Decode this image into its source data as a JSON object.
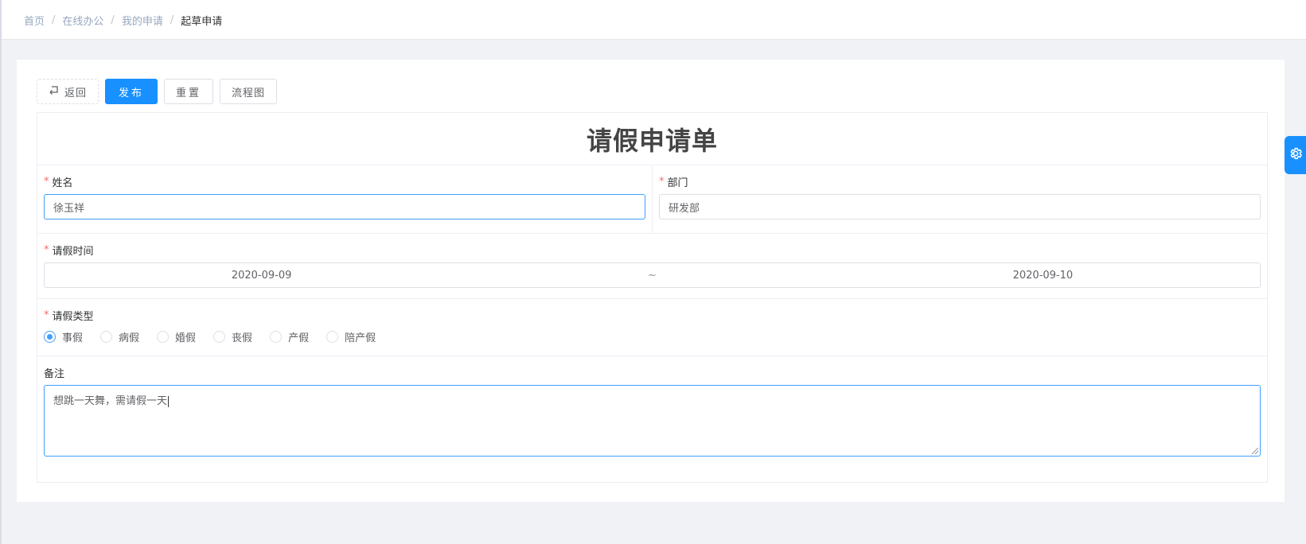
{
  "breadcrumb": {
    "items": [
      "首页",
      "在线办公",
      "我的申请"
    ],
    "current": "起草申请",
    "separator": "/"
  },
  "toolbar": {
    "back_label": "返回",
    "publish_label": "发布",
    "reset_label": "重置",
    "flowchart_label": "流程图"
  },
  "form": {
    "title": "请假申请单",
    "required_mark": "*",
    "name": {
      "label": "姓名",
      "value": "徐玉祥"
    },
    "department": {
      "label": "部门",
      "value": "研发部"
    },
    "leave_time": {
      "label": "请假时间",
      "start": "2020-09-09",
      "separator": "~",
      "end": "2020-09-10"
    },
    "leave_type": {
      "label": "请假类型",
      "options": [
        "事假",
        "病假",
        "婚假",
        "丧假",
        "产假",
        "陪产假"
      ],
      "selected": "事假"
    },
    "remark": {
      "label": "备注",
      "value": "想跳一天舞，需请假一天"
    }
  },
  "colors": {
    "primary": "#1890ff",
    "focus_border": "#409eff",
    "required": "#f56c6c",
    "page_bg": "#f0f2f5"
  },
  "icons": {
    "back": "return-arrow-icon",
    "settings": "gear-icon"
  }
}
